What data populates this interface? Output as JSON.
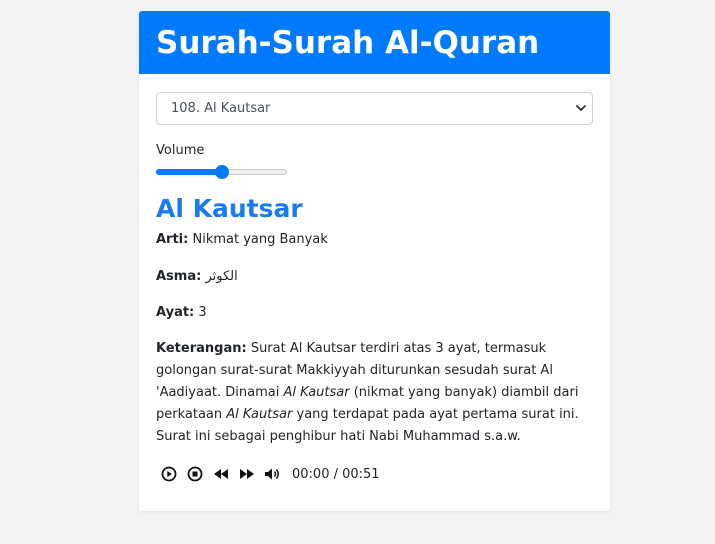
{
  "header": {
    "title": "Surah-Surah Al-Quran"
  },
  "select": {
    "value": "108. Al Kautsar"
  },
  "volume": {
    "label": "Volume",
    "level": 0.5
  },
  "surah": {
    "name": "Al Kautsar",
    "arti_label": "Arti:",
    "arti": "Nikmat yang Banyak",
    "asma_label": "Asma:",
    "asma": "الكوثر",
    "ayat_label": "Ayat:",
    "ayat": "3",
    "keterangan_label": "Keterangan:",
    "keterangan_part1": "Surat Al Kautsar terdiri atas 3 ayat, termasuk golongan surat-surat Makkiyyah diturunkan sesudah surat Al 'Aadiyaat. Dinamai",
    "keterangan_italic1": "Al Kautsar",
    "keterangan_part2": "(nikmat yang banyak) diambil dari perkataan",
    "keterangan_italic2": "Al Kautsar",
    "keterangan_part3": "yang terdapat pada ayat pertama surat ini.",
    "keterangan_line2": "Surat ini sebagai penghibur hati Nabi Muhammad s.a.w."
  },
  "player": {
    "time": "00:00 / 00:51",
    "icons": [
      "play-icon",
      "stop-icon",
      "rewind-icon",
      "fast-forward-icon",
      "volume-icon"
    ]
  },
  "colors": {
    "accent": "#007bff",
    "title": "#1a7bef"
  }
}
